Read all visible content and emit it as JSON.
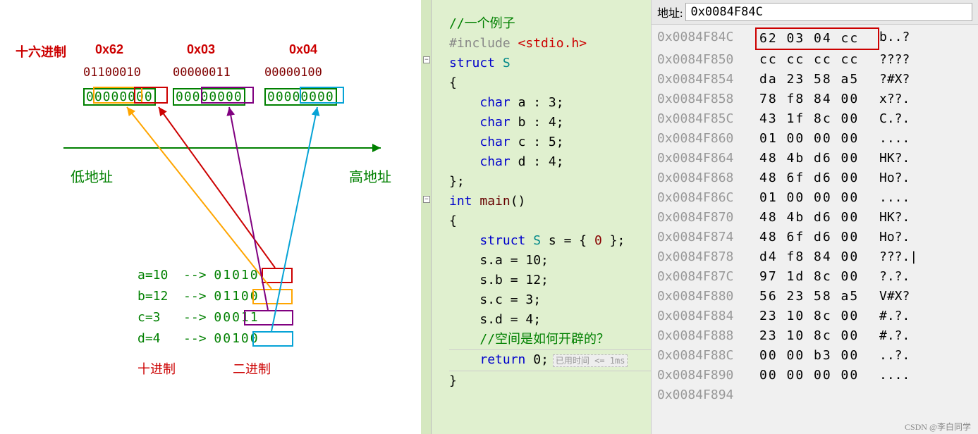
{
  "diagram": {
    "hex_label": "十六进制",
    "hex": [
      "0x62",
      "0x03",
      "0x04"
    ],
    "bin": [
      "01100010",
      "00000011",
      "00000100"
    ],
    "bytes": [
      "00000000",
      "00000000",
      "00000000"
    ],
    "low_addr": "低地址",
    "high_addr": "高地址",
    "assigns": [
      {
        "lhs": "a=10",
        "arrow": "-->",
        "bits": "01010"
      },
      {
        "lhs": "b=12",
        "arrow": "-->",
        "bits": "01100"
      },
      {
        "lhs": "c=3",
        "arrow": "-->",
        "bits": "00011"
      },
      {
        "lhs": "d=4",
        "arrow": "-->",
        "bits": "00100"
      }
    ],
    "dec_cap": "十进制",
    "bin_cap": "二进制"
  },
  "code": {
    "cmt1": "//一个例子",
    "inc": "#include ",
    "inc_hdr": "<stdio.h>",
    "struct": "struct",
    "S": "S",
    "char": "char",
    "int": "int",
    "main": "main",
    "return": "return",
    "fa": "a : 3;",
    "fb": "b : 4;",
    "fc": "c : 5;",
    "fd": "d : 4;",
    "decl": "struct S s = { 0 };",
    "sa": "s.a = 10;",
    "sb": "s.b = 12;",
    "sc": "s.c = 3;",
    "sd": "s.d = 4;",
    "cmt2": "//空间是如何开辟的？",
    "ret": " 0;",
    "hint": "已用时间 <= 1ms"
  },
  "memory": {
    "label": "地址:",
    "input": "0x0084F84C",
    "rows": [
      {
        "addr": "0x0084F84C",
        "hex": "62 03 04 cc",
        "txt": "b..?",
        "hl": true
      },
      {
        "addr": "0x0084F850",
        "hex": "cc cc cc cc",
        "txt": "????"
      },
      {
        "addr": "0x0084F854",
        "hex": "da 23 58 a5",
        "txt": "?#X?"
      },
      {
        "addr": "0x0084F858",
        "hex": "78 f8 84 00",
        "txt": "x??."
      },
      {
        "addr": "0x0084F85C",
        "hex": "43 1f 8c 00",
        "txt": "C.?."
      },
      {
        "addr": "0x0084F860",
        "hex": "01 00 00 00",
        "txt": "...."
      },
      {
        "addr": "0x0084F864",
        "hex": "48 4b d6 00",
        "txt": "HK?."
      },
      {
        "addr": "0x0084F868",
        "hex": "48 6f d6 00",
        "txt": "Ho?."
      },
      {
        "addr": "0x0084F86C",
        "hex": "01 00 00 00",
        "txt": "...."
      },
      {
        "addr": "0x0084F870",
        "hex": "48 4b d6 00",
        "txt": "HK?."
      },
      {
        "addr": "0x0084F874",
        "hex": "48 6f d6 00",
        "txt": "Ho?."
      },
      {
        "addr": "0x0084F878",
        "hex": "d4 f8 84 00",
        "txt": "???.|"
      },
      {
        "addr": "0x0084F87C",
        "hex": "97 1d 8c 00",
        "txt": "?.?."
      },
      {
        "addr": "0x0084F880",
        "hex": "56 23 58 a5",
        "txt": "V#X?"
      },
      {
        "addr": "0x0084F884",
        "hex": "23 10 8c 00",
        "txt": "#.?."
      },
      {
        "addr": "0x0084F888",
        "hex": "23 10 8c 00",
        "txt": "#.?."
      },
      {
        "addr": "0x0084F88C",
        "hex": "00 00 b3 00",
        "txt": "..?."
      },
      {
        "addr": "0x0084F890",
        "hex": "00 00 00 00",
        "txt": "...."
      },
      {
        "addr": "0x0084F894",
        "hex": "",
        "txt": ""
      }
    ]
  },
  "watermark": "CSDN @李白同学"
}
